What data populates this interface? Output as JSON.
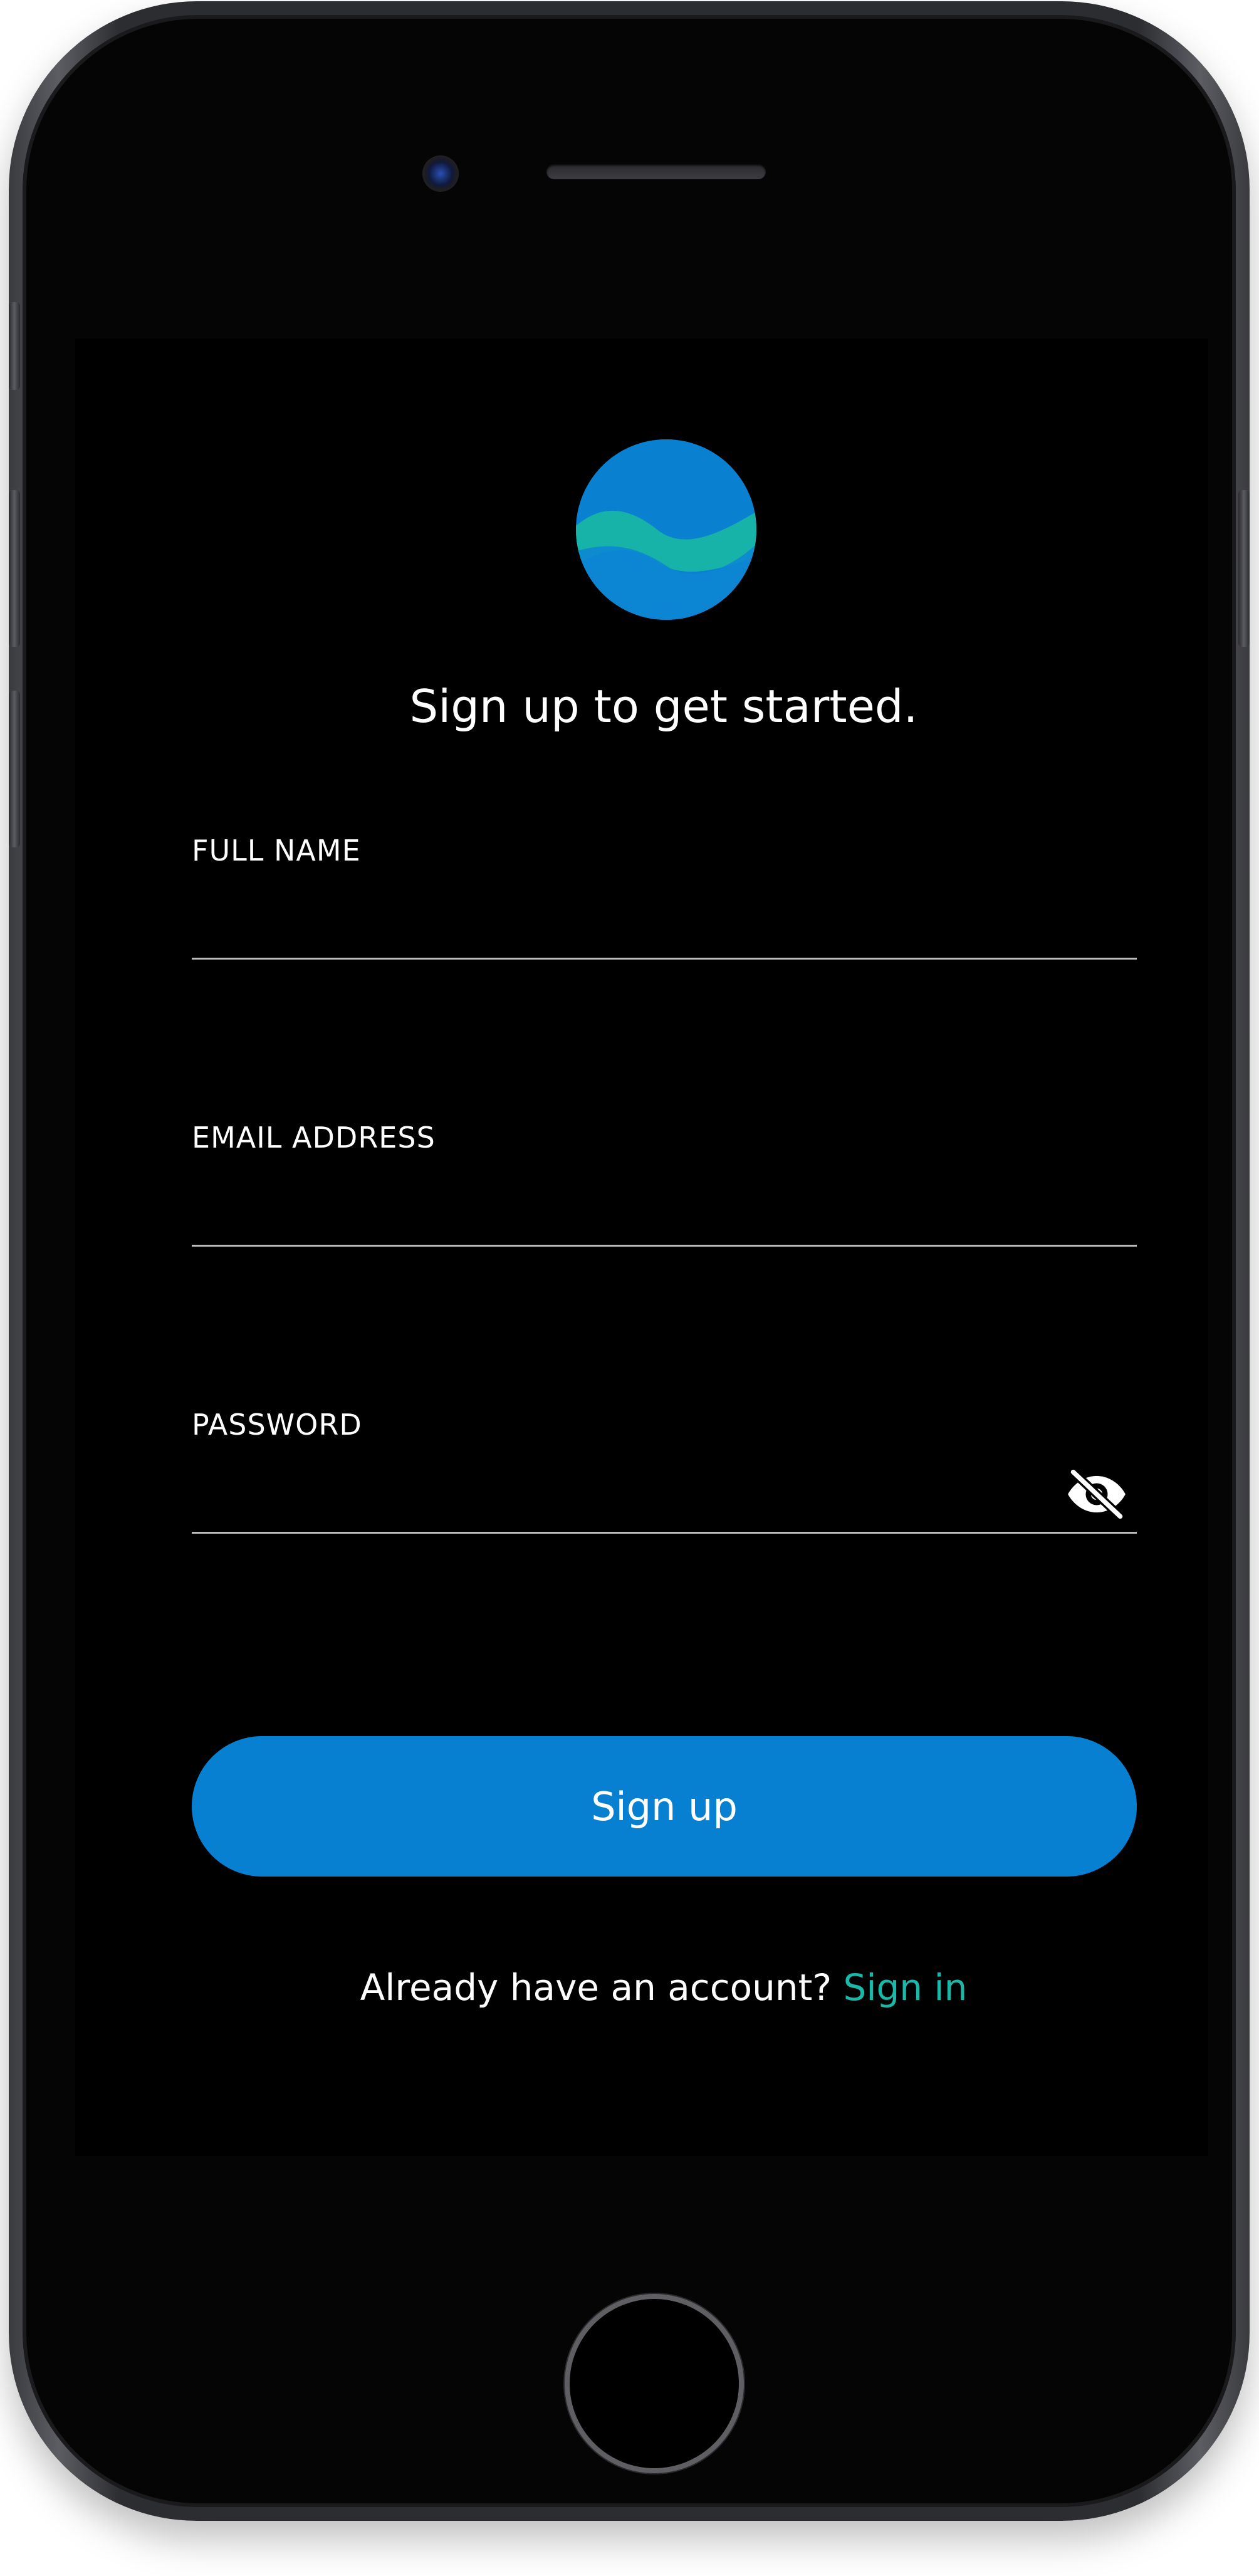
{
  "app": {
    "headline": "Sign up to get started.",
    "logo_icon": "wave-logo-icon"
  },
  "form": {
    "full_name": {
      "label": "FULL NAME",
      "value": "",
      "placeholder": ""
    },
    "email": {
      "label": "EMAIL ADDRESS",
      "value": "",
      "placeholder": ""
    },
    "password": {
      "label": "PASSWORD",
      "value": "",
      "placeholder": "",
      "toggle_icon": "eye-off-icon"
    },
    "submit_label": "Sign up"
  },
  "footer": {
    "prompt": "Already have an account? ",
    "link_label": "Sign in"
  },
  "colors": {
    "background": "#000000",
    "primary": "#0880D1",
    "accent": "#1AB8A8",
    "text": "#FFFFFF",
    "divider": "#BDBDBD"
  }
}
